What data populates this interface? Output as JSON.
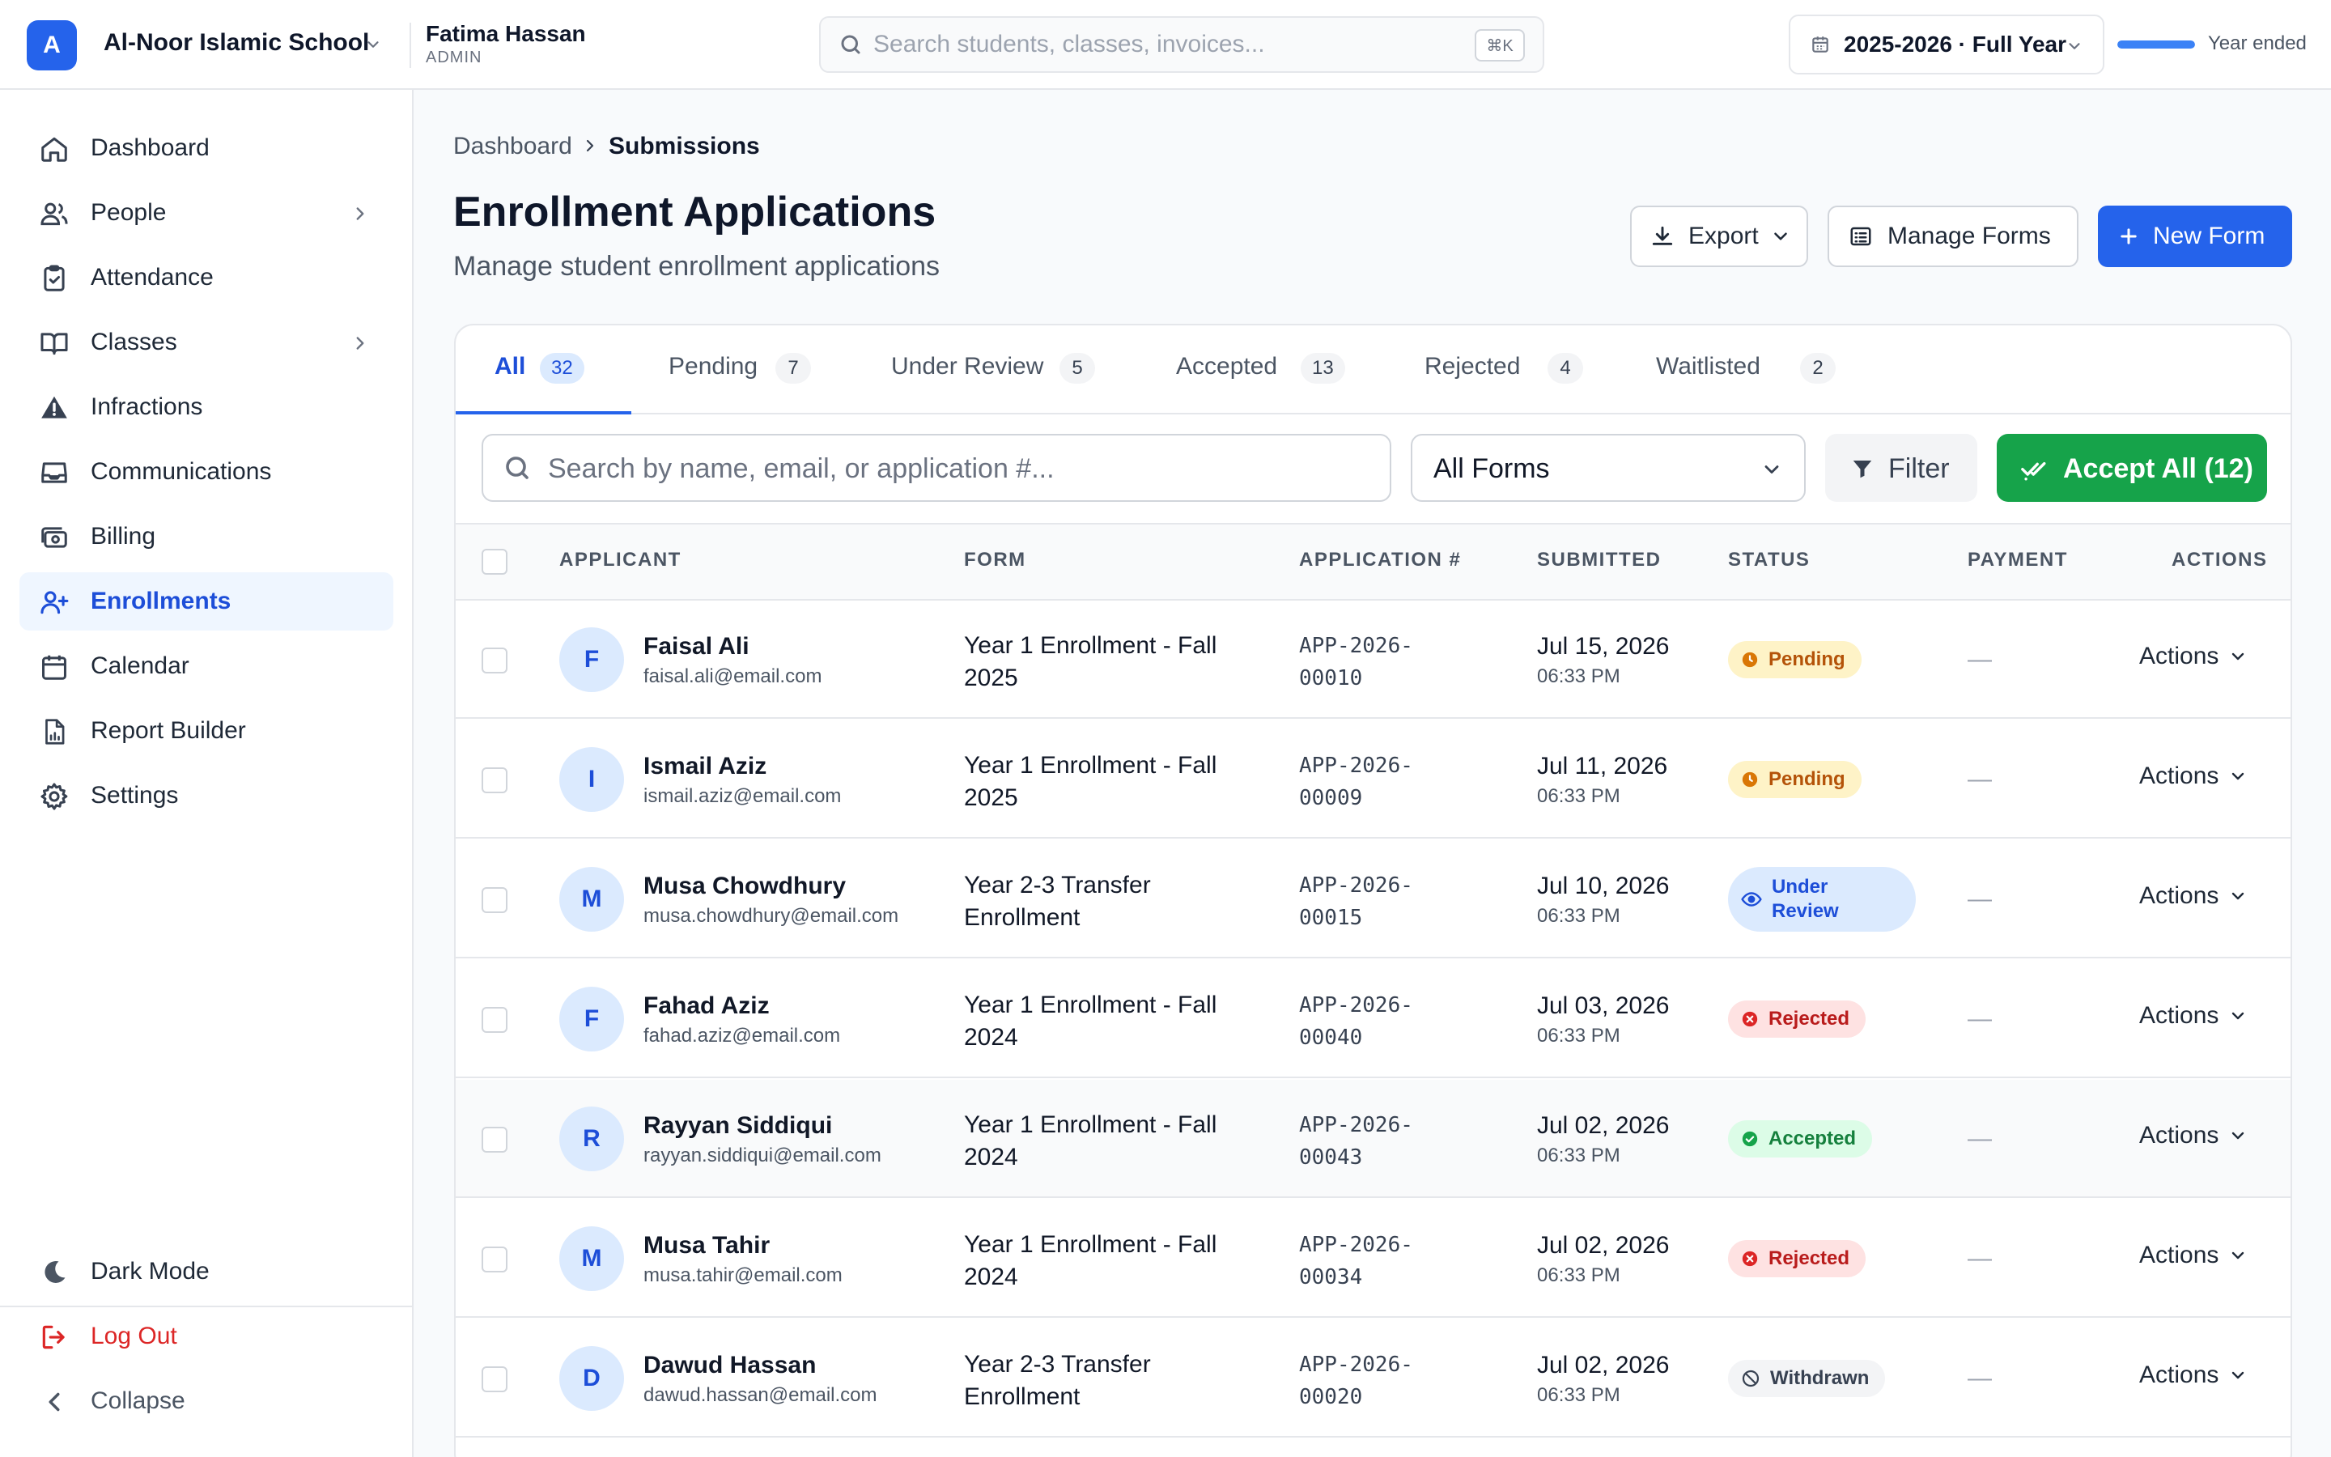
{
  "topbar": {
    "logo_letter": "A",
    "school_name": "Al-Noor Islamic School",
    "user_name": "Fatima Hassan",
    "user_role": "ADMIN",
    "search_placeholder": "Search students, classes, invoices...",
    "search_shortcut": "⌘K",
    "year_label": "2025-2026 · Full Year",
    "year_status": "Year ended",
    "year_progress": 1.0
  },
  "sidebar": {
    "items": [
      {
        "label": "Dashboard",
        "icon": "home-icon"
      },
      {
        "label": "People",
        "icon": "users-icon"
      },
      {
        "label": "Attendance",
        "icon": "clipboard-check-icon"
      },
      {
        "label": "Classes",
        "icon": "book-open-icon"
      },
      {
        "label": "Infractions",
        "icon": "warning-icon"
      },
      {
        "label": "Communications",
        "icon": "inbox-icon"
      },
      {
        "label": "Billing",
        "icon": "cash-icon"
      },
      {
        "label": "Enrollments",
        "icon": "user-plus-icon"
      },
      {
        "label": "Calendar",
        "icon": "calendar-icon"
      },
      {
        "label": "Report Builder",
        "icon": "report-icon"
      },
      {
        "label": "Settings",
        "icon": "gear-icon"
      }
    ],
    "dark_mode": "Dark Mode",
    "log_out": "Log Out",
    "collapse": "Collapse"
  },
  "breadcrumb": {
    "parent": "Dashboard",
    "current": "Submissions"
  },
  "page": {
    "title": "Enrollment Applications",
    "subtitle": "Manage student enrollment applications",
    "export_label": "Export",
    "manage_forms_label": "Manage Forms",
    "new_form_label": "New Form"
  },
  "tabs": [
    {
      "label": "All",
      "count": "32"
    },
    {
      "label": "Pending",
      "count": "7"
    },
    {
      "label": "Under Review",
      "count": "5"
    },
    {
      "label": "Accepted",
      "count": "13"
    },
    {
      "label": "Rejected",
      "count": "4"
    },
    {
      "label": "Waitlisted",
      "count": "2"
    }
  ],
  "toolbar": {
    "search_placeholder": "Search by name, email, or application #...",
    "forms_select": "All Forms",
    "filter_label": "Filter",
    "accept_all_label": "Accept All (12)"
  },
  "table": {
    "headers": {
      "applicant": "APPLICANT",
      "form": "FORM",
      "application": "APPLICATION #",
      "submitted": "SUBMITTED",
      "status": "STATUS",
      "payment": "PAYMENT",
      "actions": "ACTIONS"
    },
    "actions_label": "Actions",
    "payment_empty": "—",
    "rows": [
      {
        "initial": "F",
        "name": "Faisal Ali",
        "email": "faisal.ali@email.com",
        "form": "Year 1 Enrollment - Fall 2025",
        "app_num_1": "APP-2026-",
        "app_num_2": "00010",
        "date": "Jul 15, 2026",
        "time": "06:33 PM",
        "status": "Pending"
      },
      {
        "initial": "I",
        "name": "Ismail Aziz",
        "email": "ismail.aziz@email.com",
        "form": "Year 1 Enrollment - Fall 2025",
        "app_num_1": "APP-2026-",
        "app_num_2": "00009",
        "date": "Jul 11, 2026",
        "time": "06:33 PM",
        "status": "Pending"
      },
      {
        "initial": "M",
        "name": "Musa Chowdhury",
        "email": "musa.chowdhury@email.com",
        "form": "Year 2-3 Transfer Enrollment",
        "app_num_1": "APP-2026-",
        "app_num_2": "00015",
        "date": "Jul 10, 2026",
        "time": "06:33 PM",
        "status": "Under Review"
      },
      {
        "initial": "F",
        "name": "Fahad Aziz",
        "email": "fahad.aziz@email.com",
        "form": "Year 1 Enrollment - Fall 2024",
        "app_num_1": "APP-2026-",
        "app_num_2": "00040",
        "date": "Jul 03, 2026",
        "time": "06:33 PM",
        "status": "Rejected"
      },
      {
        "initial": "R",
        "name": "Rayyan Siddiqui",
        "email": "rayyan.siddiqui@email.com",
        "form": "Year 1 Enrollment - Fall 2024",
        "app_num_1": "APP-2026-",
        "app_num_2": "00043",
        "date": "Jul 02, 2026",
        "time": "06:33 PM",
        "status": "Accepted"
      },
      {
        "initial": "M",
        "name": "Musa Tahir",
        "email": "musa.tahir@email.com",
        "form": "Year 1 Enrollment - Fall 2024",
        "app_num_1": "APP-2026-",
        "app_num_2": "00034",
        "date": "Jul 02, 2026",
        "time": "06:33 PM",
        "status": "Rejected"
      },
      {
        "initial": "D",
        "name": "Dawud Hassan",
        "email": "dawud.hassan@email.com",
        "form": "Year 2-3 Transfer Enrollment",
        "app_num_1": "APP-2026-",
        "app_num_2": "00020",
        "date": "Jul 02, 2026",
        "time": "06:33 PM",
        "status": "Withdrawn"
      }
    ]
  },
  "colors": {
    "primary": "#2563eb",
    "success": "#16a34a",
    "danger": "#dc2626",
    "pending": "#d97706"
  }
}
